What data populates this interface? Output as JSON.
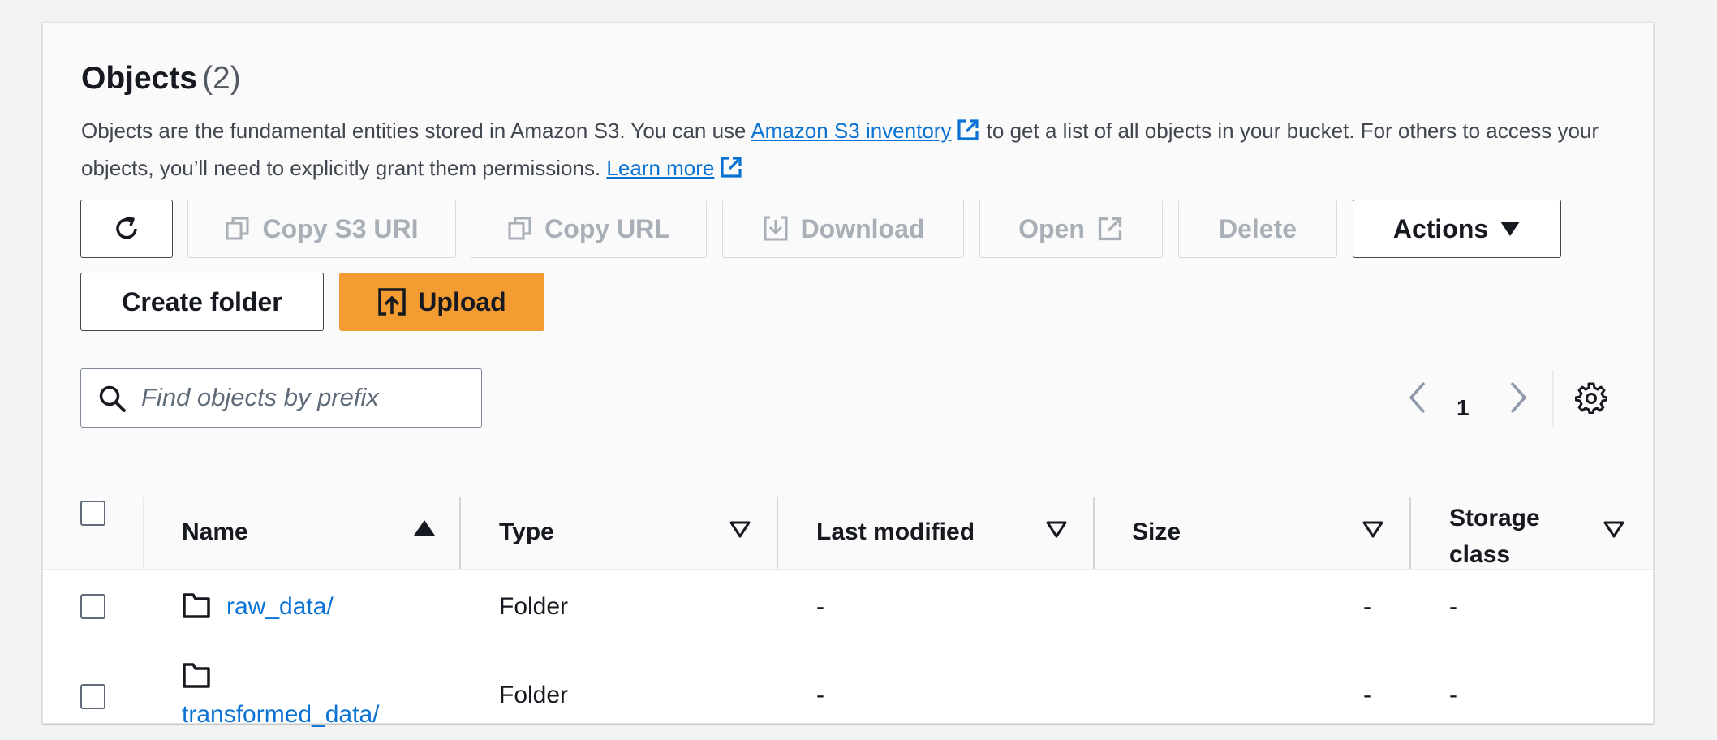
{
  "header": {
    "title": "Objects",
    "count": "(2)"
  },
  "description": {
    "text_1": "Objects are the fundamental entities stored in Amazon S3. You can use ",
    "inventory_link": "Amazon S3 inventory",
    "text_2": " to get a list of all objects in your bucket. For others to access your objects, you’ll need to explicitly grant them permissions. ",
    "learn_more_link": "Learn more"
  },
  "toolbar": {
    "copy_s3_uri": "Copy S3 URI",
    "copy_url": "Copy URL",
    "download": "Download",
    "open": "Open",
    "delete": "Delete",
    "actions": "Actions",
    "create_folder": "Create folder",
    "upload": "Upload"
  },
  "search": {
    "placeholder": "Find objects by prefix",
    "value": ""
  },
  "pagination": {
    "current_page": "1"
  },
  "table": {
    "columns": {
      "name": "Name",
      "type": "Type",
      "last_modified": "Last modified",
      "size": "Size",
      "storage_class_1": "Storage",
      "storage_class_2": "class"
    },
    "rows": [
      {
        "name": "raw_data/",
        "type": "Folder",
        "last_modified": "-",
        "size": "-",
        "storage_class": "-"
      },
      {
        "name": "transformed_data/",
        "type": "Folder",
        "last_modified": "-",
        "size": "-",
        "storage_class": "-"
      }
    ]
  },
  "colors": {
    "primary_button": "#f39c32",
    "link": "#0972d3",
    "disabled_text": "#a8afb7"
  },
  "icons": [
    "refresh-icon",
    "copy-icon",
    "download-icon",
    "external-link-icon",
    "caret-down-icon",
    "upload-icon",
    "search-icon",
    "chevron-left-icon",
    "chevron-right-icon",
    "settings-icon",
    "sort-ascending-icon",
    "sort-icon",
    "folder-icon"
  ]
}
